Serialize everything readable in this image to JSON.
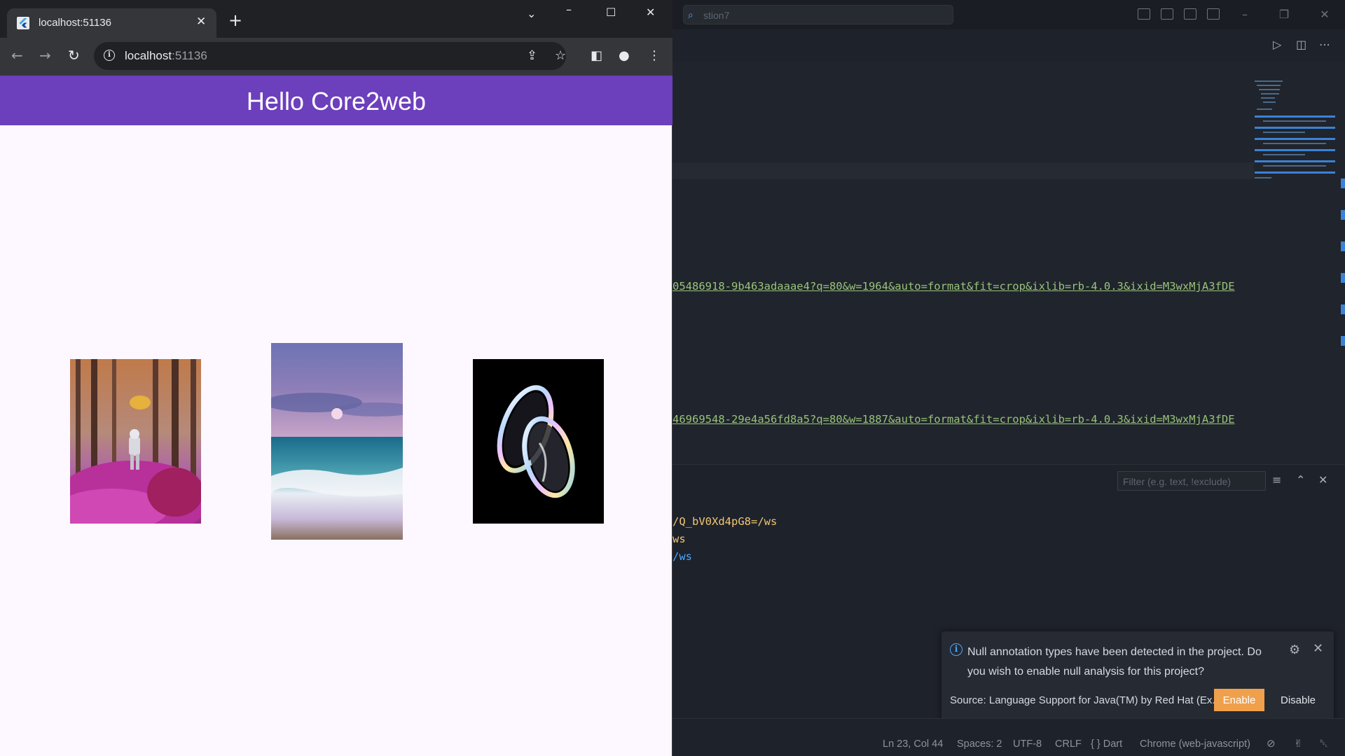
{
  "vscode": {
    "search_text": "stion7",
    "code_lines": [
      "05486918-9b463adaaae4?q=80&w=1964&auto=format&fit=crop&ixlib=rb-4.0.3&ixid=M3wxMjA3fDE",
      "46969548-29e4a56fd8a5?q=80&w=1887&auto=format&fit=crop&ixlib=rb-4.0.3&ixid=M3wxMjA3fDE"
    ],
    "panel_filter_placeholder": "Filter (e.g. text, !exclude)",
    "terminal_lines": [
      "/Q_bV0Xd4pG8=/ws",
      "ws",
      "/ws"
    ],
    "notification": {
      "message": "Null annotation types have been detected in the project. Do you wish to enable null analysis for this project?",
      "source": "Source: Language Support for Java(TM) by Red Hat (Ex...",
      "enable_label": "Enable",
      "disable_label": "Disable"
    },
    "status": {
      "position": "Ln 23, Col 44",
      "spaces": "Spaces: 2",
      "encoding": "UTF-8",
      "eol": "CRLF",
      "language": "{ } Dart",
      "device": "Chrome (web-javascript)"
    }
  },
  "chrome": {
    "tab_title": "localhost:51136",
    "url_host": "localhost",
    "url_port": ":51136",
    "app_title": "Hello Core2web"
  },
  "colors": {
    "app_bar": "#6c3fbc",
    "page_bg": "#fdf8ff",
    "enable_button": "#f0a04b",
    "code_string": "#98c379"
  },
  "images": [
    {
      "name": "astronaut-in-pink-forest"
    },
    {
      "name": "ocean-waves-under-moon"
    },
    {
      "name": "iridescent-glass-shapes"
    }
  ]
}
